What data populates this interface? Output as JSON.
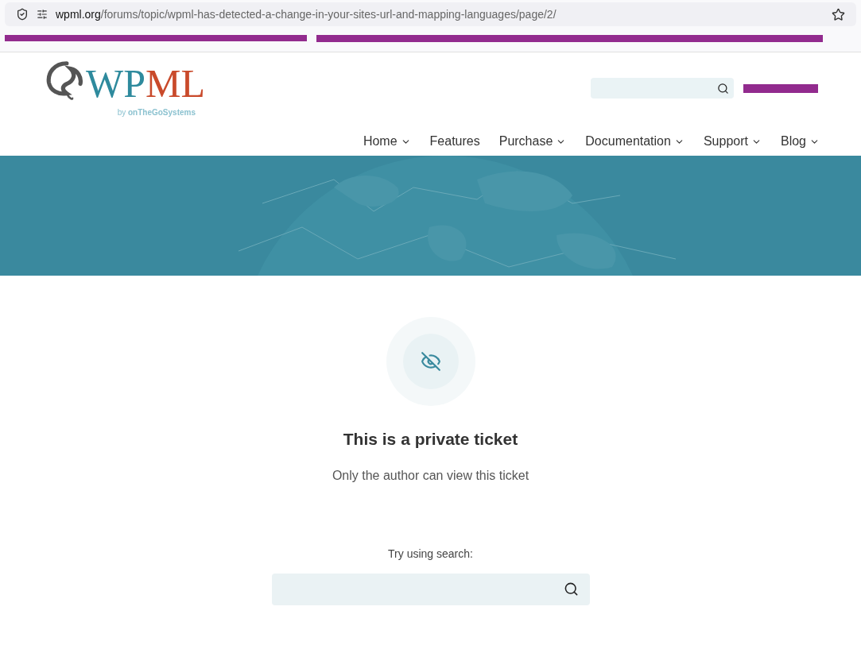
{
  "browser": {
    "url_host": "wpml.org",
    "url_path": "/forums/topic/wpml-has-detected-a-change-in-your-sites-url-and-mapping-languages/page/2/"
  },
  "header": {
    "logo": {
      "letters_a": "WP",
      "letters_b": "ML",
      "by": "by",
      "company": "onTheGoSystems"
    },
    "nav": [
      {
        "label": "Home",
        "dropdown": true
      },
      {
        "label": "Features",
        "dropdown": false
      },
      {
        "label": "Purchase",
        "dropdown": true
      },
      {
        "label": "Documentation",
        "dropdown": true
      },
      {
        "label": "Support",
        "dropdown": true
      },
      {
        "label": "Blog",
        "dropdown": true
      }
    ]
  },
  "notice": {
    "title": "This is a private ticket",
    "message": "Only the author can view this ticket",
    "search_label": "Try using search:"
  }
}
